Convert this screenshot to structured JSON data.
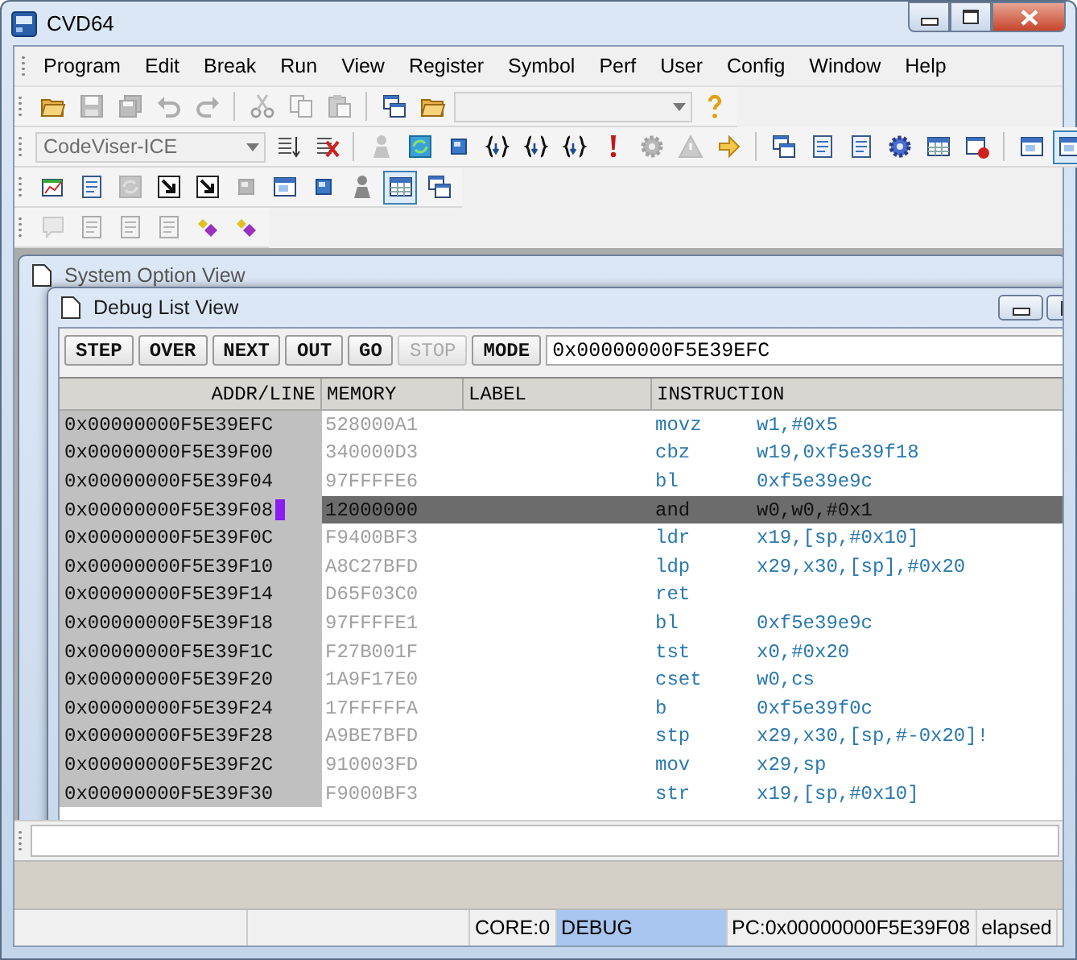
{
  "window": {
    "title": "CVD64"
  },
  "menu": [
    "Program",
    "Edit",
    "Break",
    "Run",
    "View",
    "Register",
    "Symbol",
    "Perf",
    "User",
    "Config",
    "Window",
    "Help"
  ],
  "toolbars": [
    {
      "items": [
        {
          "kind": "folder",
          "disabled": false
        },
        {
          "kind": "disk",
          "disabled": true
        },
        {
          "kind": "disks",
          "disabled": true
        },
        {
          "kind": "undo",
          "disabled": true
        },
        {
          "kind": "redo",
          "disabled": true
        },
        {
          "kind": "separator"
        },
        {
          "kind": "scissors",
          "disabled": true
        },
        {
          "kind": "copy",
          "disabled": true
        },
        {
          "kind": "paste",
          "disabled": true
        },
        {
          "kind": "separator"
        },
        {
          "kind": "windows",
          "disabled": false
        },
        {
          "kind": "folder",
          "disabled": false
        },
        {
          "kind": "combo",
          "disabled": true
        },
        {
          "kind": "help",
          "disabled": false
        }
      ]
    },
    {
      "items": [
        {
          "kind": "combo",
          "value": "CodeViser-ICE",
          "disabled": true
        },
        {
          "kind": "list",
          "disabled": false
        },
        {
          "kind": "erase",
          "disabled": false
        },
        {
          "kind": "separator"
        },
        {
          "kind": "person",
          "disabled": true
        },
        {
          "kind": "refresh",
          "disabled": false
        },
        {
          "kind": "square",
          "disabled": false
        },
        {
          "kind": "brace",
          "disabled": false
        },
        {
          "kind": "brace",
          "disabled": false
        },
        {
          "kind": "brace",
          "disabled": false
        },
        {
          "kind": "exclaim",
          "disabled": false
        },
        {
          "kind": "gear",
          "disabled": true
        },
        {
          "kind": "warning",
          "disabled": true
        },
        {
          "kind": "arrow",
          "disabled": false
        },
        {
          "kind": "separator"
        },
        {
          "kind": "windows",
          "disabled": false
        },
        {
          "kind": "doc",
          "disabled": false
        },
        {
          "kind": "doc",
          "disabled": false
        },
        {
          "kind": "gear",
          "disabled": false
        },
        {
          "kind": "table",
          "disabled": false
        },
        {
          "kind": "record",
          "disabled": false
        },
        {
          "kind": "separator"
        },
        {
          "kind": "window",
          "disabled": false
        },
        {
          "kind": "window",
          "disabled": false,
          "pressed": true
        }
      ]
    },
    {
      "items": [
        {
          "kind": "chart",
          "disabled": false
        },
        {
          "kind": "doc",
          "disabled": false
        },
        {
          "kind": "refresh",
          "disabled": true
        },
        {
          "kind": "boxarrow",
          "disabled": false
        },
        {
          "kind": "boxarrow",
          "disabled": false
        },
        {
          "kind": "square",
          "disabled": true
        },
        {
          "kind": "window",
          "disabled": false
        },
        {
          "kind": "square",
          "disabled": false
        },
        {
          "kind": "person",
          "disabled": false
        },
        {
          "kind": "table",
          "disabled": false,
          "pressed": true
        },
        {
          "kind": "windows",
          "disabled": false
        }
      ]
    },
    {
      "items": [
        {
          "kind": "bubble",
          "disabled": true
        },
        {
          "kind": "doc",
          "disabled": true
        },
        {
          "kind": "doc",
          "disabled": true
        },
        {
          "kind": "doc",
          "disabled": true
        },
        {
          "kind": "diamonds",
          "disabled": false
        },
        {
          "kind": "diamonds",
          "disabled": false
        }
      ]
    }
  ],
  "background_window": {
    "title": "System Option View"
  },
  "debug_view": {
    "title": "Debug List View",
    "buttons": [
      {
        "label": "STEP",
        "disabled": false
      },
      {
        "label": "OVER",
        "disabled": false
      },
      {
        "label": "NEXT",
        "disabled": false
      },
      {
        "label": "OUT",
        "disabled": false
      },
      {
        "label": "GO",
        "disabled": false
      },
      {
        "label": "STOP",
        "disabled": true
      },
      {
        "label": "MODE",
        "disabled": false
      }
    ],
    "address": "0x00000000F5E39EFC",
    "columns": [
      "ADDR/LINE",
      "MEMORY",
      "LABEL",
      "INSTRUCTION"
    ],
    "rows": [
      {
        "addr": "0x00000000F5E39EFC",
        "memory": "528000A1",
        "mnemonic": "movz",
        "operands": "w1,#0x5",
        "selected": false,
        "pc": false
      },
      {
        "addr": "0x00000000F5E39F00",
        "memory": "340000D3",
        "mnemonic": "cbz",
        "operands": "w19,0xf5e39f18",
        "selected": false,
        "pc": false
      },
      {
        "addr": "0x00000000F5E39F04",
        "memory": "97FFFFE6",
        "mnemonic": "bl",
        "operands": "0xf5e39e9c",
        "selected": false,
        "pc": false
      },
      {
        "addr": "0x00000000F5E39F08",
        "memory": "12000000",
        "mnemonic": "and",
        "operands": "w0,w0,#0x1",
        "selected": true,
        "pc": true
      },
      {
        "addr": "0x00000000F5E39F0C",
        "memory": "F9400BF3",
        "mnemonic": "ldr",
        "operands": "x19,[sp,#0x10]",
        "selected": false,
        "pc": false
      },
      {
        "addr": "0x00000000F5E39F10",
        "memory": "A8C27BFD",
        "mnemonic": "ldp",
        "operands": "x29,x30,[sp],#0x20",
        "selected": false,
        "pc": false
      },
      {
        "addr": "0x00000000F5E39F14",
        "memory": "D65F03C0",
        "mnemonic": "ret",
        "operands": "",
        "selected": false,
        "pc": false
      },
      {
        "addr": "0x00000000F5E39F18",
        "memory": "97FFFFE1",
        "mnemonic": "bl",
        "operands": "0xf5e39e9c",
        "selected": false,
        "pc": false
      },
      {
        "addr": "0x00000000F5E39F1C",
        "memory": "F27B001F",
        "mnemonic": "tst",
        "operands": "x0,#0x20",
        "selected": false,
        "pc": false
      },
      {
        "addr": "0x00000000F5E39F20",
        "memory": "1A9F17E0",
        "mnemonic": "cset",
        "operands": "w0,cs",
        "selected": false,
        "pc": false
      },
      {
        "addr": "0x00000000F5E39F24",
        "memory": "17FFFFFA",
        "mnemonic": "b",
        "operands": "0xf5e39f0c",
        "selected": false,
        "pc": false
      },
      {
        "addr": "0x00000000F5E39F28",
        "memory": "A9BE7BFD",
        "mnemonic": "stp",
        "operands": "x29,x30,[sp,#-0x20]!",
        "selected": false,
        "pc": false
      },
      {
        "addr": "0x00000000F5E39F2C",
        "memory": "910003FD",
        "mnemonic": "mov",
        "operands": "x29,sp",
        "selected": false,
        "pc": false
      },
      {
        "addr": "0x00000000F5E39F30",
        "memory": "F9000BF3",
        "mnemonic": "str",
        "operands": "x19,[sp,#0x10]",
        "selected": false,
        "pc": false
      }
    ]
  },
  "status_bar": [
    {
      "text": "CORE:0",
      "highlighted": false
    },
    {
      "text": "DEBUG",
      "highlighted": true
    },
    {
      "text": "PC:0x00000000F5E39F08",
      "highlighted": false
    },
    {
      "text": "elapsed",
      "highlighted": false
    }
  ]
}
